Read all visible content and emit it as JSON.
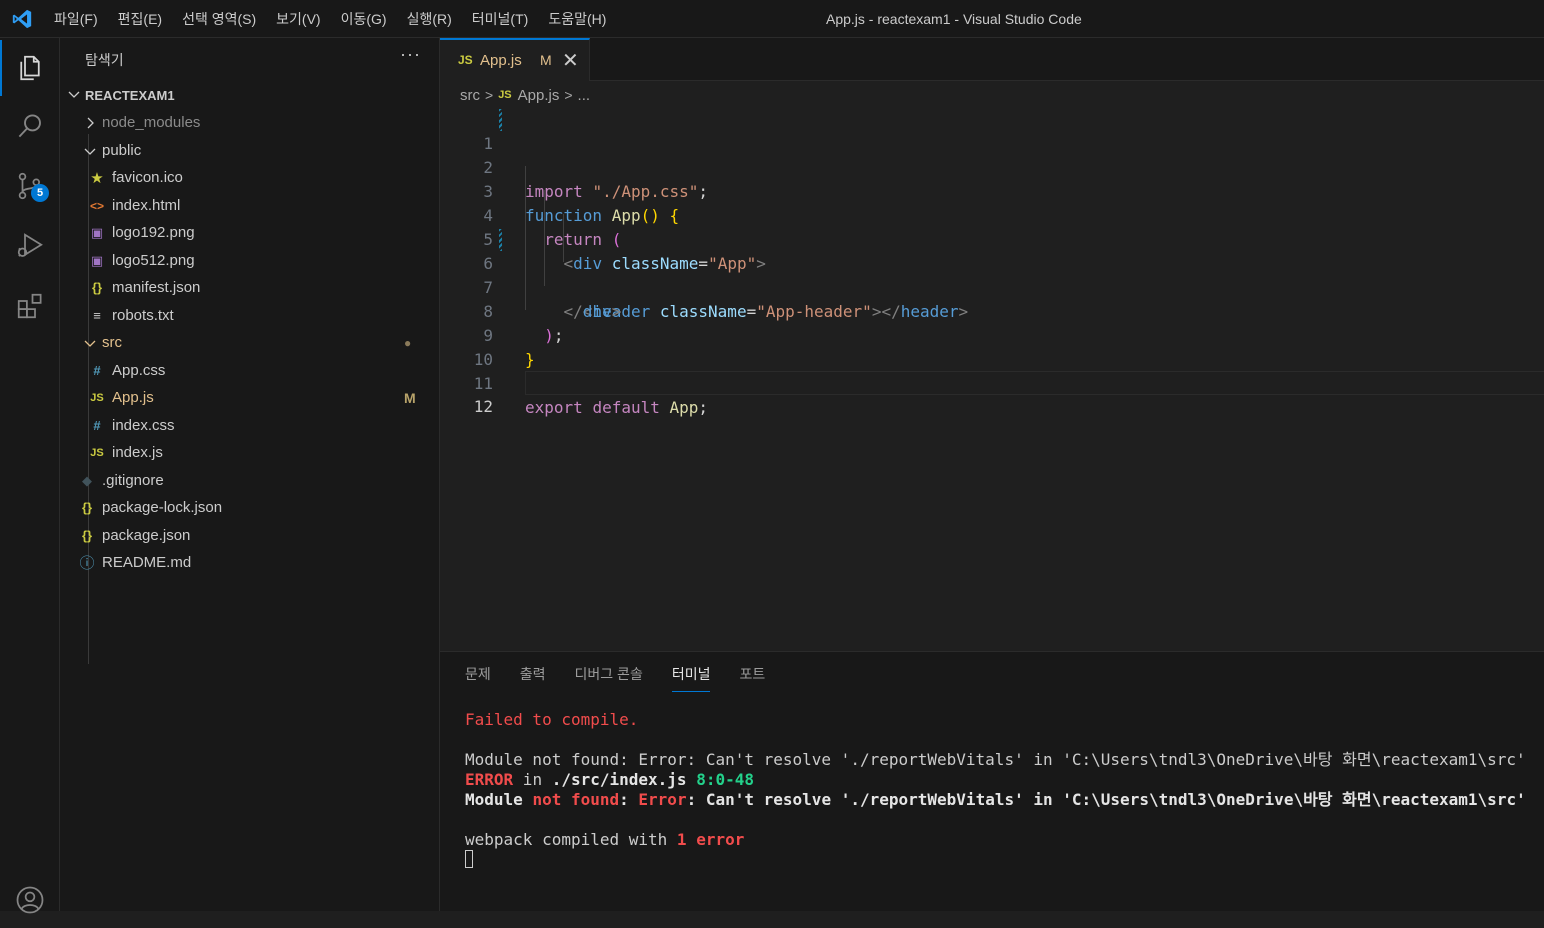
{
  "window": {
    "title": "App.js - reactexam1 - Visual Studio Code"
  },
  "menu": [
    "파일(F)",
    "편집(E)",
    "선택 영역(S)",
    "보기(V)",
    "이동(G)",
    "실행(R)",
    "터미널(T)",
    "도움말(H)"
  ],
  "activity_bar": {
    "items": [
      "explorer-icon",
      "search-icon",
      "source-control-icon",
      "run-debug-icon",
      "extensions-icon",
      "account-icon"
    ],
    "scm_badge": "5",
    "accent": "#0078d4"
  },
  "sidebar": {
    "title": "탐색기",
    "more": "···",
    "workspace": "REACTEXAM1",
    "tree": [
      {
        "name": "node_modules",
        "icon": ">",
        "type": "folder-collapsed"
      },
      {
        "name": "public",
        "icon": "⌄",
        "type": "folder-open"
      },
      {
        "name": "favicon.ico",
        "icon": "★",
        "type": "file"
      },
      {
        "name": "index.html",
        "icon": "<>",
        "type": "file"
      },
      {
        "name": "logo192.png",
        "icon": "▣",
        "type": "file"
      },
      {
        "name": "logo512.png",
        "icon": "▣",
        "type": "file"
      },
      {
        "name": "manifest.json",
        "icon": "{}",
        "type": "file"
      },
      {
        "name": "robots.txt",
        "icon": "≡",
        "type": "file"
      },
      {
        "name": "src",
        "icon": "⌄",
        "type": "folder-open",
        "deco": "●"
      },
      {
        "name": "App.css",
        "icon": "#",
        "type": "file"
      },
      {
        "name": "App.js",
        "icon": "JS",
        "type": "file",
        "deco": "M"
      },
      {
        "name": "index.css",
        "icon": "#",
        "type": "file"
      },
      {
        "name": "index.js",
        "icon": "JS",
        "type": "file"
      },
      {
        "name": ".gitignore",
        "icon": "◆",
        "type": "file"
      },
      {
        "name": "package-lock.json",
        "icon": "{}",
        "type": "file"
      },
      {
        "name": "package.json",
        "icon": "{}",
        "type": "file"
      },
      {
        "name": "README.md",
        "icon": "ⓘ",
        "type": "file"
      }
    ]
  },
  "editor": {
    "tab": {
      "icon": "JS",
      "label": "App.js",
      "status": "M",
      "close": "✕"
    },
    "breadcrumb": {
      "folder": "src",
      "file_icon": "JS",
      "file": "App.js",
      "more": "..."
    },
    "line_numbers": [
      "1",
      "2",
      "3",
      "4",
      "5",
      "6",
      "7",
      "8",
      "9",
      "10",
      "11",
      "12"
    ],
    "code": {
      "l1_kw": "import",
      "l1_str": "\"./App.css\"",
      "l1_end": ";",
      "l3_kw": "function",
      "l3_fn": "App",
      "l3_par": "()",
      "l3_br": "{",
      "l4_kw": "return",
      "l4_par": "(",
      "l5_open": "<",
      "l5_tag": "div",
      "l5_attr": "className",
      "l5_eq": "=",
      "l5_val": "\"App\"",
      "l5_close": ">",
      "l6_open": "<",
      "l6_tag": "header",
      "l6_attr": "className",
      "l6_eq": "=",
      "l6_val": "\"App-header\"",
      "l6_mid": "></",
      "l6_tag2": "header",
      "l6_close": ">",
      "l7_open": "</",
      "l7_tag": "div",
      "l7_close": ">",
      "l8_par": ")",
      "l8_end": ";",
      "l9_br": "}",
      "l11_kw1": "export",
      "l11_kw2": "default",
      "l11_var": "App",
      "l11_end": ";"
    }
  },
  "panel": {
    "tabs": [
      "문제",
      "출력",
      "디버그 콘솔",
      "터미널",
      "포트"
    ],
    "active_tab": "터미널",
    "terminal": {
      "line1": "Failed to compile.",
      "line2": "Module not found: Error: Can't resolve './reportWebVitals' in 'C:\\Users\\tndl3\\OneDrive\\바탕 화면\\reactexam1\\src'",
      "line3_err": "ERROR",
      "line3_in": " in ",
      "line3_file": "./src/index.js",
      "line3_sp": " ",
      "line3_pos": "8:0-48",
      "line4_a": "Module ",
      "line4_b": "not found",
      "line4_c": ": ",
      "line4_d": "Error",
      "line4_e": ": Can't resolve './reportWebVitals' in 'C:\\Users\\tndl3\\OneDrive\\바탕 화면\\reactexam1\\src'",
      "line5_a": "webpack compiled with ",
      "line5_b": "1",
      "line5_c": " ",
      "line5_d": "error"
    }
  }
}
